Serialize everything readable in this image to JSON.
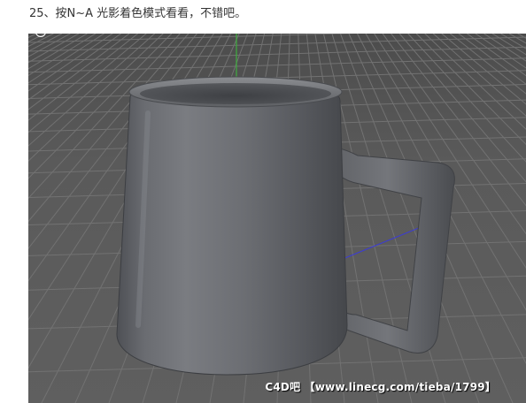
{
  "caption": {
    "text": "25、按N~A 光影着色模式看看，不错吧。"
  },
  "viewport": {
    "background_color": "#5a5a5a",
    "grid_line_color": "#6e6e6e",
    "y_axis_color": "#3fae3f",
    "x_axis_color": "#3b3bd6",
    "object": "mug-model",
    "object_color": "#6f7176"
  },
  "watermark": {
    "text": "C4D吧 【www.linecg.com/tieba/1799】"
  },
  "icons": {
    "corner_handle": "circle-handle-icon"
  }
}
